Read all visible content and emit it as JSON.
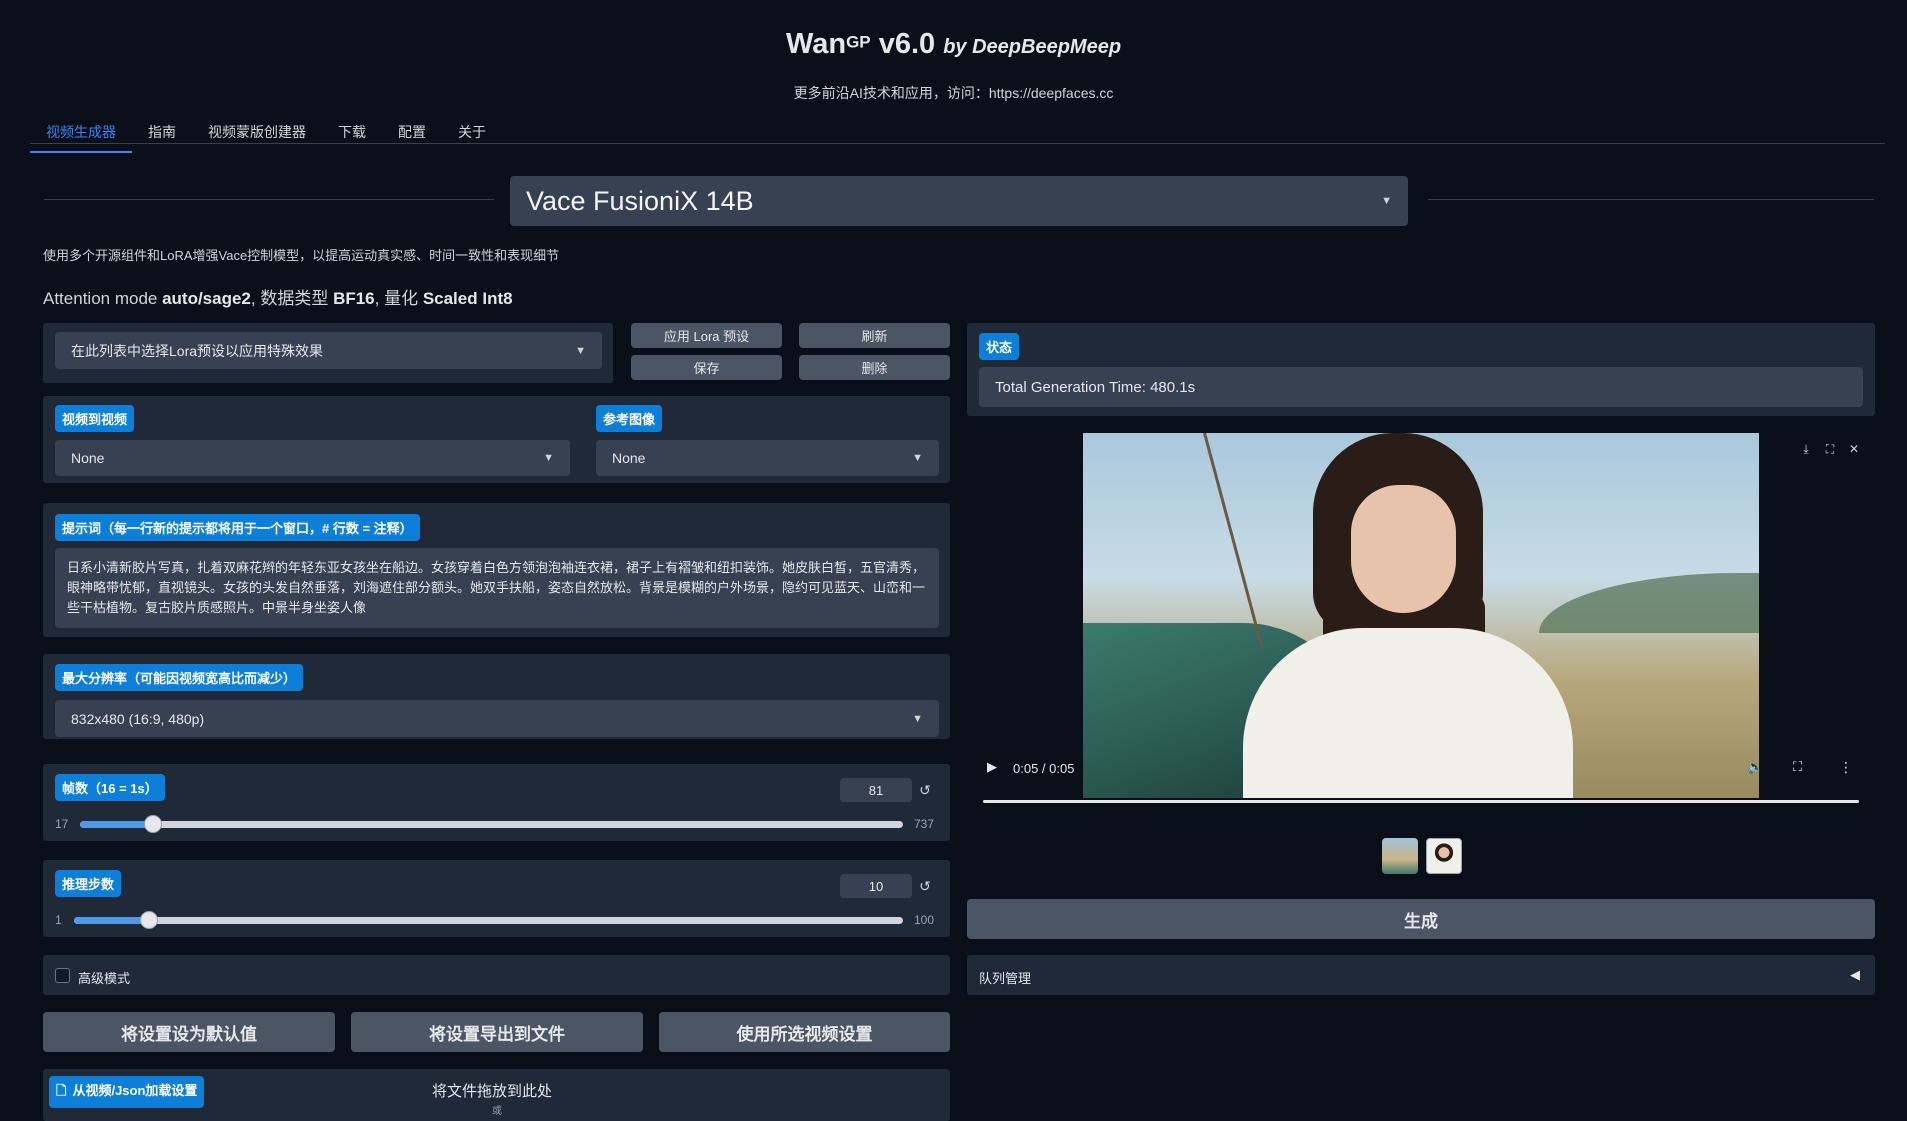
{
  "header": {
    "app_name": "Wan",
    "app_sup": "GP",
    "version": " v6.0 ",
    "by": "by DeepBeepMeep",
    "subtitle": "更多前沿AI技术和应用，访问：https://deepfaces.cc"
  },
  "tabs": [
    "视频生成器",
    "指南",
    "视频蒙版创建器",
    "下载",
    "配置",
    "关于"
  ],
  "model": {
    "selected": "Vace FusioniX 14B"
  },
  "model_desc": "使用多个开源组件和LoRA增强Vace控制模型，以提高运动真实感、时间一致性和表现细节",
  "attention": {
    "prefix": "Attention mode ",
    "mode": "auto/sage2",
    "sep1": ", 数据类型 ",
    "dtype": "BF16",
    "sep2": ", 量化 ",
    "quant": "Scaled Int8"
  },
  "lora": {
    "placeholder": "在此列表中选择Lora预设以应用特殊效果",
    "apply_label": "应用 Lora 预设",
    "refresh_label": "刷新",
    "save_label": "保存",
    "delete_label": "删除"
  },
  "video_to_video": {
    "label": "视频到视频",
    "value": "None"
  },
  "reference_image": {
    "label": "参考图像",
    "value": "None"
  },
  "prompt": {
    "label": "提示词（每一行新的提示都将用于一个窗口，# 行数 = 注释）",
    "value": "日系小清新胶片写真，扎着双麻花辫的年轻东亚女孩坐在船边。女孩穿着白色方领泡泡袖连衣裙，裙子上有褶皱和纽扣装饰。她皮肤白皙，五官清秀，眼神略带忧郁，直视镜头。女孩的头发自然垂落，刘海遮住部分额头。她双手扶船，姿态自然放松。背景是模糊的户外场景，隐约可见蓝天、山峦和一些干枯植物。复古胶片质感照片。中景半身坐姿人像"
  },
  "resolution": {
    "label": "最大分辨率（可能因视频宽高比而减少）",
    "value": "832x480 (16:9, 480p)"
  },
  "frames": {
    "label": "帧数（16 = 1s）",
    "value": 81,
    "min": 17,
    "max": 737
  },
  "steps": {
    "label": "推理步数",
    "value": 10,
    "min": 1,
    "max": 100
  },
  "advanced": {
    "label": "高级模式",
    "checked": false
  },
  "actions": {
    "set_default": "将设置设为默认值",
    "export": "将设置导出到文件",
    "use_selected": "使用所选视频设置"
  },
  "load_settings": {
    "label": "从视频/Json加载设置",
    "drop_text": "将文件拖放到此处",
    "drop_sub": "或"
  },
  "status": {
    "label": "状态",
    "value": "Total Generation Time: 480.1s"
  },
  "video": {
    "time": "0:05 / 0:05",
    "progress": 1.0
  },
  "generate_label": "生成",
  "queue": {
    "label": "队列管理",
    "arrow": "◀"
  },
  "icons": {
    "play": "play-icon",
    "download": "download-icon",
    "fullscreen": "fullscreen-icon",
    "close": "close-icon",
    "volume": "volume-icon",
    "more": "more-vert-icon",
    "reset": "reset-icon",
    "file": "file-icon",
    "dropdown": "chevron-down-icon"
  },
  "colors": {
    "accent": "#0e7fd8",
    "background": "#0b0f19",
    "panel": "#1f2937",
    "input": "#374151"
  }
}
